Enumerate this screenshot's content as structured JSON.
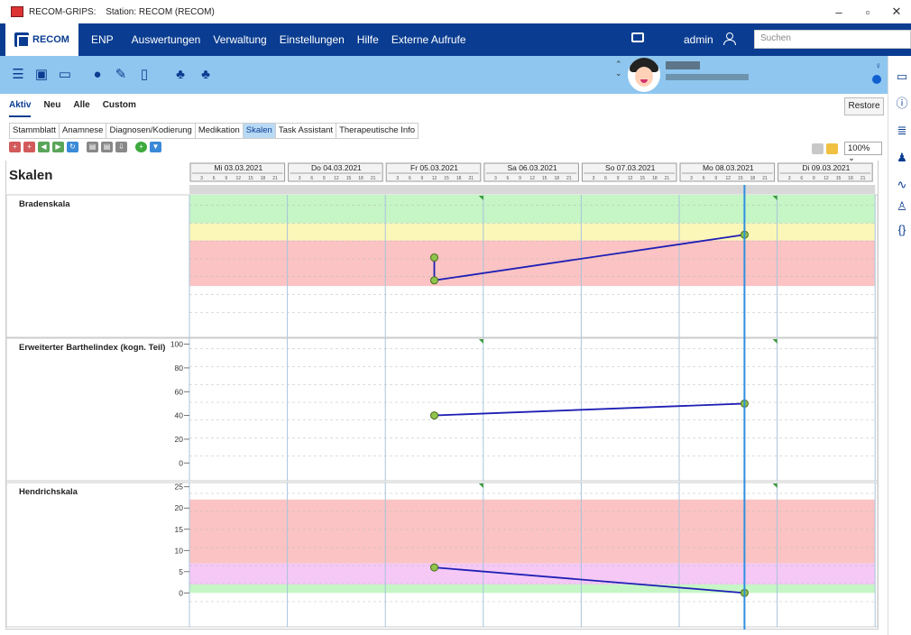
{
  "window": {
    "title": "RECOM-GRIPS:",
    "station": "Station: RECOM (RECOM)",
    "controls": [
      "–",
      "▫",
      "✕"
    ]
  },
  "menubar": {
    "logo": "RECOM",
    "items": [
      "ENP",
      "Auswertungen",
      "Verwaltung",
      "Einstellungen",
      "Hilfe",
      "Externe Aufrufe"
    ],
    "user": "admin",
    "search_placeholder": "Suchen"
  },
  "subtabs": [
    "Aktiv",
    "Neu",
    "Alle",
    "Custom"
  ],
  "restore_label": "Restore",
  "tabs": [
    "Stammblatt",
    "Anamnese",
    "Diagnosen/Kodierung",
    "Medikation",
    "Skalen",
    "Task Assistant",
    "Therapeutische Info"
  ],
  "active_tab": "Skalen",
  "zoom": "100%",
  "page_title": "Skalen",
  "colors": {
    "menubar": "#0a3d91",
    "toolbar": "#8ec6ef",
    "band_green": "#c6f5c6",
    "band_yellow": "#fbf7b8",
    "band_red": "#fbc3c3",
    "band_pink": "#f5c8f5",
    "line": "#1f1fb5",
    "point": "#8fc44a",
    "cursor": "#2f8fe0"
  },
  "chart_data": {
    "type": "line",
    "days": [
      "Mi 03.03.2021",
      "Do 04.03.2021",
      "Fr 05.03.2021",
      "Sa 06.03.2021",
      "So 07.03.2021",
      "Mo 08.03.2021",
      "Di 09.03.2021"
    ],
    "hour_ticks": [
      "3",
      "6",
      "9",
      "12",
      "15",
      "18",
      "21"
    ],
    "current_time": "2021-03-08T16:00",
    "panels": [
      {
        "name": "Bradenskala",
        "ylim": [
          0,
          25
        ],
        "ticks": [],
        "bands": [
          {
            "from": 20,
            "to": 25,
            "color": "green"
          },
          {
            "from": 17,
            "to": 20,
            "color": "yellow"
          },
          {
            "from": 9,
            "to": 17,
            "color": "red"
          }
        ],
        "points": [
          {
            "t": "2021-03-05T12:00",
            "y": 14
          },
          {
            "t": "2021-03-05T12:00",
            "y": 10
          },
          {
            "t": "2021-03-08T16:00",
            "y": 18
          }
        ]
      },
      {
        "name": "Erweiterter Barthelindex (kogn. Teil)",
        "ylim": [
          -15,
          105
        ],
        "ticks": [
          100,
          80,
          60,
          40,
          20,
          0
        ],
        "bands": [],
        "points": [
          {
            "t": "2021-03-05T12:00",
            "y": 40
          },
          {
            "t": "2021-03-08T16:00",
            "y": 50
          }
        ]
      },
      {
        "name": "Hendrichskala",
        "ylim": [
          -8,
          26
        ],
        "ticks": [
          25,
          20,
          15,
          10,
          5,
          0
        ],
        "bands": [
          {
            "from": 7,
            "to": 22,
            "color": "red"
          },
          {
            "from": 2,
            "to": 7,
            "color": "pink"
          },
          {
            "from": 0,
            "to": 2,
            "color": "green"
          }
        ],
        "points": [
          {
            "t": "2021-03-05T12:00",
            "y": 6
          },
          {
            "t": "2021-03-08T16:00",
            "y": 0
          }
        ]
      }
    ]
  }
}
